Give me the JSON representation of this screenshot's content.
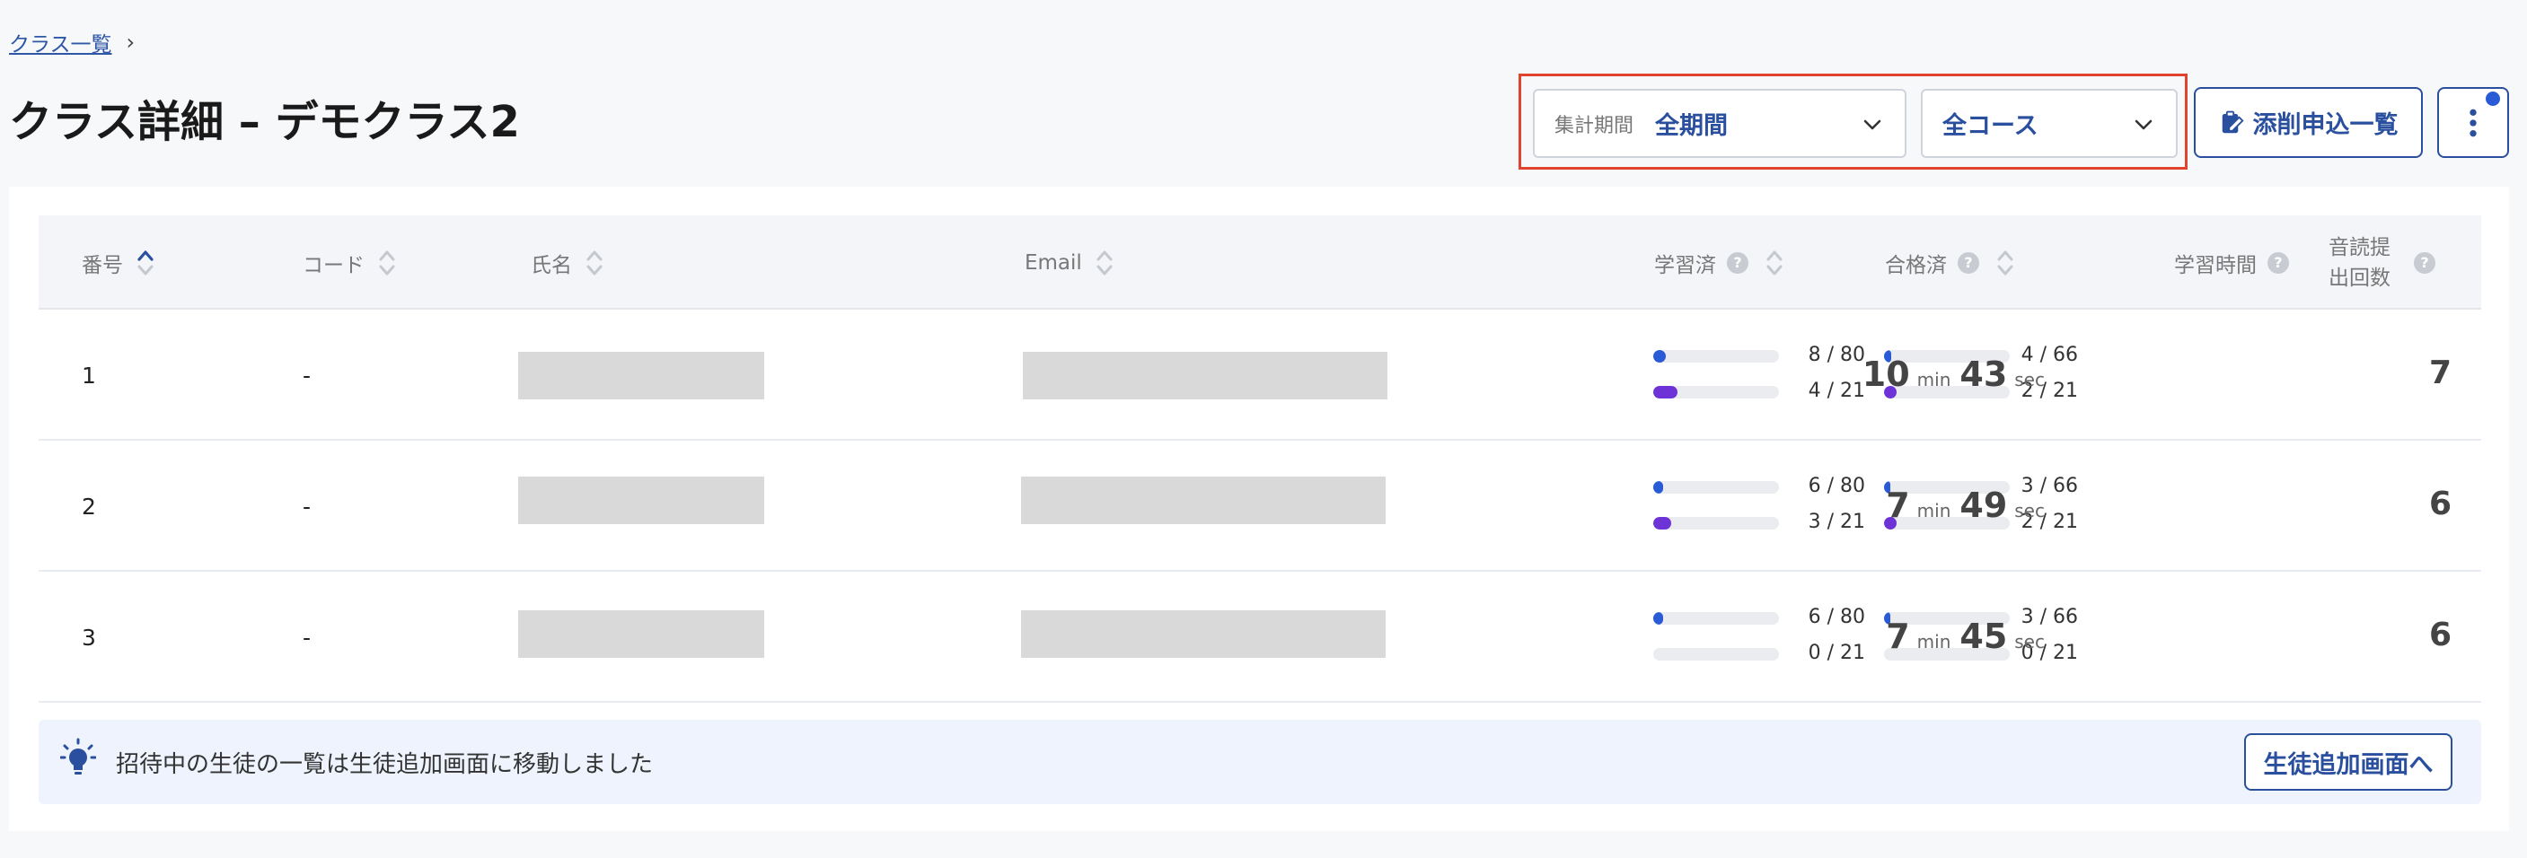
{
  "breadcrumb": {
    "link": "クラス一覧",
    "separator": "›"
  },
  "page_title": "クラス詳細 – デモクラス2",
  "filters": {
    "period_label": "集計期間",
    "period_value": "全期間",
    "course_value": "全コース"
  },
  "toolbar": {
    "apply_list_label": "添削申込一覧"
  },
  "table": {
    "headers": {
      "number": "番号",
      "code": "コード",
      "name": "氏名",
      "email": "Email",
      "studied": "学習済",
      "passed": "合格済",
      "study_time": "学習時間",
      "reading_count_1": "音読提",
      "reading_count_2": "出回数"
    },
    "help_glyph": "?",
    "time_units": {
      "min": "min",
      "sec": "sec"
    },
    "rows": [
      {
        "number": "1",
        "code": "-",
        "studied_a": "8 / 80",
        "studied_b": "4 / 21",
        "passed_a": "4 / 66",
        "passed_b": "2 / 21",
        "minutes": "10",
        "seconds": "43",
        "reading_count": "7"
      },
      {
        "number": "2",
        "code": "-",
        "studied_a": "6 / 80",
        "studied_b": "3 / 21",
        "passed_a": "3 / 66",
        "passed_b": "2 / 21",
        "minutes": "7",
        "seconds": "49",
        "reading_count": "6"
      },
      {
        "number": "3",
        "code": "-",
        "studied_a": "6 / 80",
        "studied_b": "0 / 21",
        "passed_a": "3 / 66",
        "passed_b": "0 / 21",
        "minutes": "7",
        "seconds": "45",
        "reading_count": "6"
      }
    ]
  },
  "notice": {
    "message": "招待中の生徒の一覧は生徒追加画面に移動しました",
    "button_label": "生徒追加画面へ"
  },
  "colors": {
    "accent": "#2a4f9e",
    "highlight_frame": "#e0442f",
    "bar_blue": "#2a5bd7",
    "bar_purple": "#6e33d6"
  }
}
